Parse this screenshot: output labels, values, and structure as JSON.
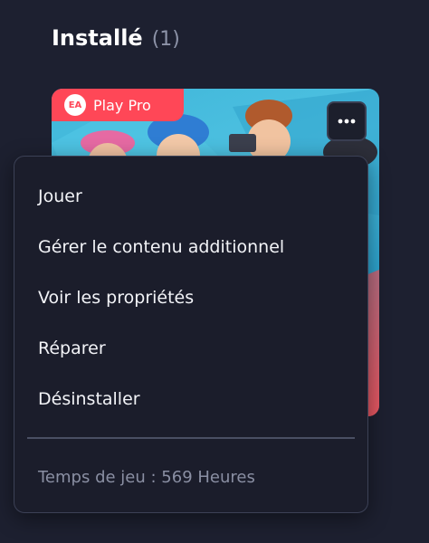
{
  "section": {
    "title": "Installé",
    "count": "(1)"
  },
  "game_card": {
    "badge_logo": "EA",
    "badge_text": "Play Pro",
    "more_button_icon": "more-horizontal-icon",
    "badge_color": "#ff4757"
  },
  "context_menu": {
    "items": [
      {
        "label": "Jouer"
      },
      {
        "label": "Gérer le contenu additionnel"
      },
      {
        "label": "Voir les propriétés"
      },
      {
        "label": "Réparer"
      },
      {
        "label": "Désinstaller"
      }
    ],
    "playtime": "Temps de jeu : 569 Heures"
  }
}
